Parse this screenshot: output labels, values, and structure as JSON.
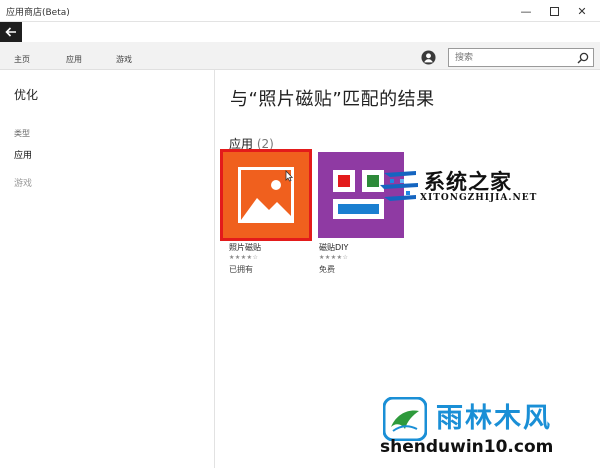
{
  "window": {
    "title": "应用商店(Beta)",
    "minimize_glyph": "—",
    "close_glyph": "✕"
  },
  "nav": {
    "home": "主页",
    "apps": "应用",
    "games": "游戏",
    "search_placeholder": "搜索"
  },
  "sidebar": {
    "refine_title": "优化",
    "category_label": "类型",
    "categories": [
      {
        "label": "应用",
        "selected": true
      },
      {
        "label": "游戏",
        "selected": false
      }
    ]
  },
  "results": {
    "title": "与“照片磁贴”匹配的结果",
    "section_label": "应用",
    "section_count": "(2)",
    "apps": [
      {
        "name": "照片磁贴",
        "rating": "★★★★☆",
        "price": "已拥有",
        "tile_color": "#f0601e",
        "selected": true
      },
      {
        "name": "磁贴DIY",
        "rating": "★★★★☆",
        "price": "免费",
        "tile_color": "#8f3aa3",
        "selected": false
      }
    ]
  },
  "watermarks": {
    "site1_name": "系统之家",
    "site1_url": "XITONGZHIJIA.NET",
    "site2_name": "雨林木风",
    "site2_domain": "shenduwin10.com"
  },
  "colors": {
    "accent_selection": "#e31b1b",
    "back_button_bg": "#1f1f1f",
    "navbar_bg": "#f2f2f2"
  },
  "icons": {
    "back": "arrow-left-icon",
    "avatar": "user-avatar-icon",
    "search": "magnifier-icon",
    "photo": "photo-icon"
  }
}
